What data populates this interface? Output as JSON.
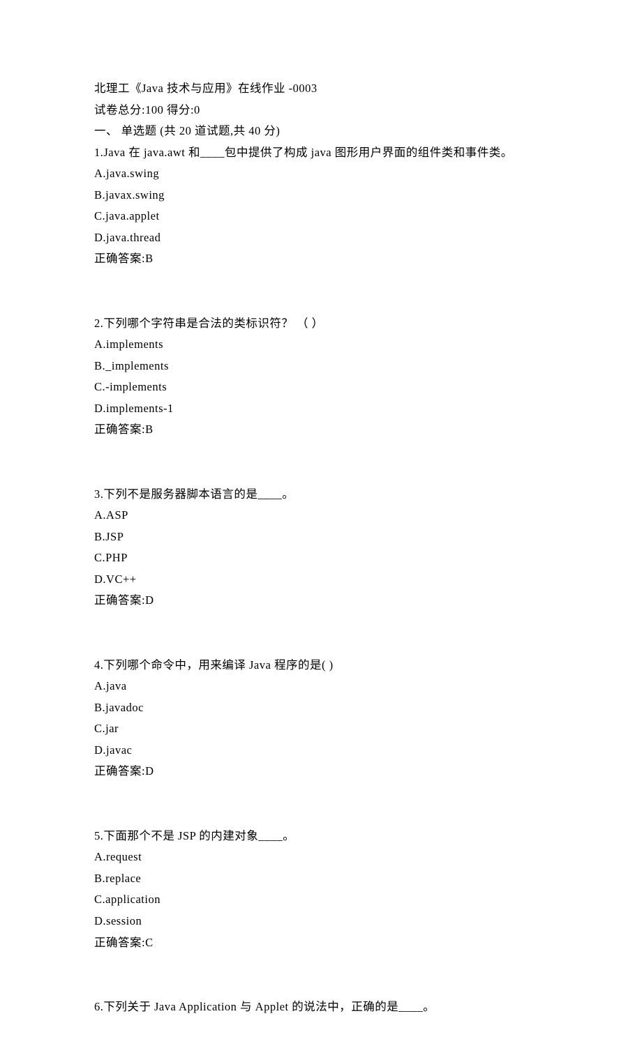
{
  "header": {
    "title": "北理工《Java 技术与应用》在线作业    -0003",
    "score_line": "试卷总分:100    得分:0",
    "section_line": "一、 单选题 (共 20 道试题,共 40 分)"
  },
  "questions": [
    {
      "stem": "1.Java 在 java.awt 和____包中提供了构成 java 图形用户界面的组件类和事件类。",
      "options": [
        "A.java.swing",
        "B.javax.swing",
        "C.java.applet",
        "D.java.thread"
      ],
      "answer": "正确答案:B"
    },
    {
      "stem": "2.下列哪个字符串是合法的类标识符？ （ ）",
      "options": [
        "A.implements",
        "B._implements",
        "C.-implements",
        "D.implements-1"
      ],
      "answer": "正确答案:B"
    },
    {
      "stem": "3.下列不是服务器脚本语言的是____。",
      "options": [
        "A.ASP",
        "B.JSP",
        "C.PHP",
        "D.VC++"
      ],
      "answer": "正确答案:D"
    },
    {
      "stem": "4.下列哪个命令中，用来编译 Java 程序的是( )",
      "options": [
        "A.java",
        "B.javadoc",
        "C.jar",
        "D.javac"
      ],
      "answer": "正确答案:D"
    },
    {
      "stem": "5.下面那个不是 JSP 的内建对象____。",
      "options": [
        "A.request",
        "B.replace",
        "C.application",
        "D.session"
      ],
      "answer": "正确答案:C"
    },
    {
      "stem": "6.下列关于 Java Application 与 Applet 的说法中，正确的是____。",
      "options": [],
      "answer": null
    }
  ]
}
